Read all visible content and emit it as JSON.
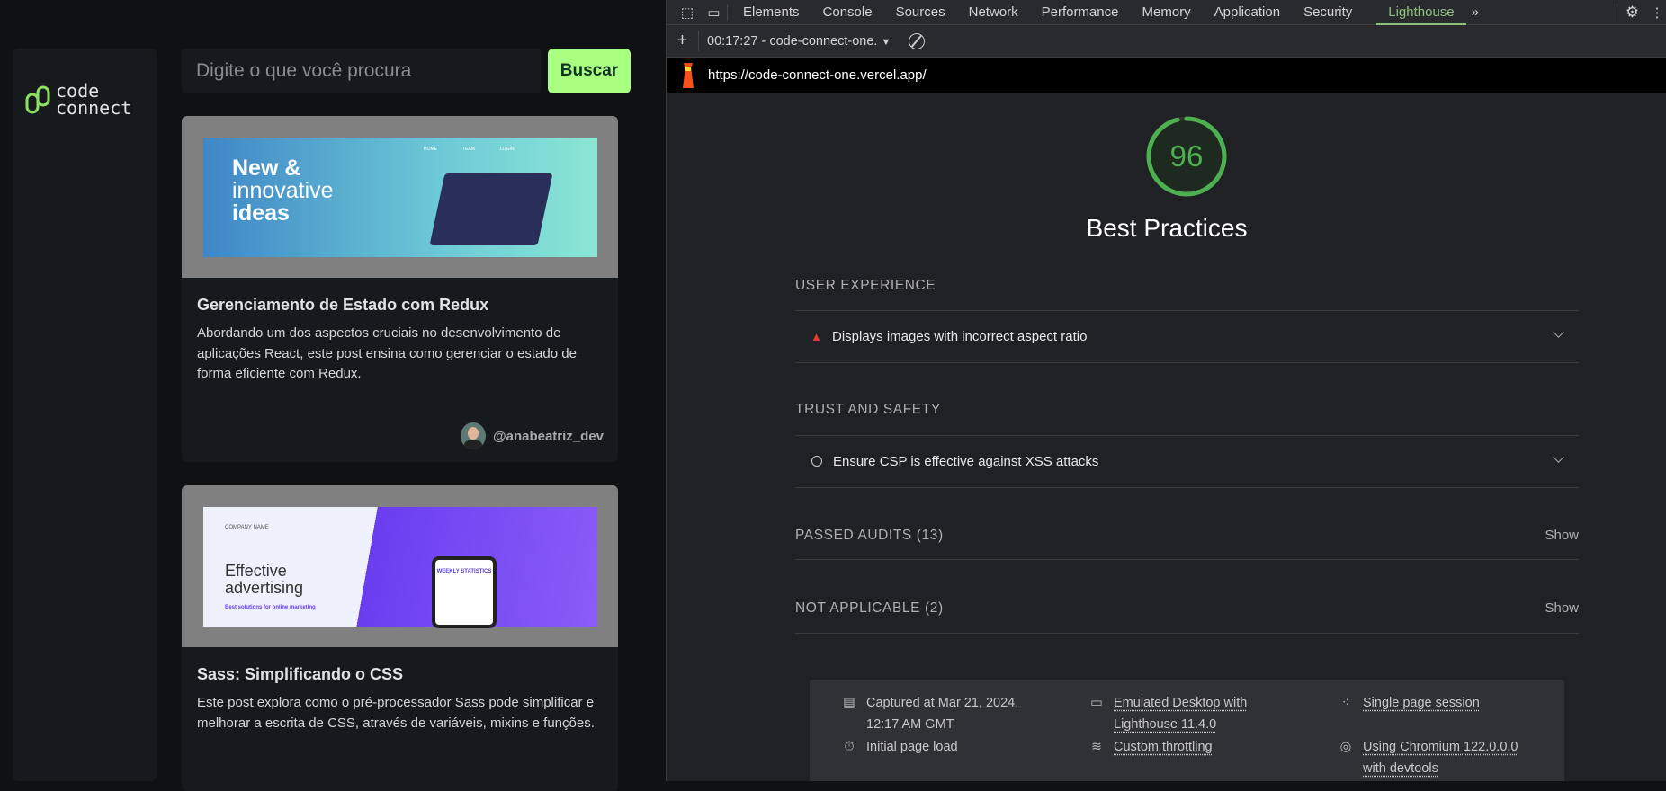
{
  "app": {
    "logo": [
      "code",
      "connect"
    ],
    "search_placeholder": "Digite o que você procura",
    "search_button": "Buscar",
    "posts": [
      {
        "title": "Gerenciamento de Estado com Redux",
        "description": "Abordando um dos aspectos cruciais no desenvolvimento de aplicações React, este post ensina como gerenciar o estado de forma eficiente com Redux.",
        "author": "@anabeatriz_dev",
        "image_text": [
          "New &",
          "innovative",
          "ideas"
        ],
        "image_nav": [
          "HOME",
          "TEAM",
          "LOGIN"
        ]
      },
      {
        "title": "Sass: Simplificando o CSS",
        "description": "Este post explora como o pré-processador Sass pode simplificar e melhorar a escrita de CSS, através de variáveis, mixins e funções.",
        "image_text": [
          "Effective",
          "advertising",
          "Best solutions for online marketing"
        ],
        "image_brand": "COMPANY NAME",
        "image_phone": "WEEKLY STATISTICS"
      }
    ]
  },
  "devtools": {
    "tabs": [
      "Elements",
      "Console",
      "Sources",
      "Network",
      "Performance",
      "Memory",
      "Application",
      "Security",
      "Lighthouse"
    ],
    "active_tab": "Lighthouse",
    "report_select": "00:17:27 - code-connect-one.",
    "url": "https://code-connect-one.vercel.app/",
    "score": "96",
    "score_color": "#4caf50",
    "category": "Best Practices",
    "sections": {
      "ux": "USER EXPERIENCE",
      "trust": "TRUST AND SAFETY",
      "passed": "PASSED AUDITS",
      "passed_count": "(13)",
      "na": "NOT APPLICABLE",
      "na_count": "(2)",
      "show": "Show"
    },
    "audits": {
      "ux_item": "Displays images with incorrect aspect ratio",
      "trust_item": "Ensure CSP is effective against XSS attacks"
    },
    "footer": {
      "captured": "Captured at Mar 21, 2024, 12:17 AM GMT",
      "load": "Initial page load",
      "emulated": "Emulated Desktop with Lighthouse 11.4.0",
      "throttling": "Custom throttling",
      "session": "Single page session",
      "chromium": "Using Chromium 122.0.0.0 with devtools"
    }
  }
}
